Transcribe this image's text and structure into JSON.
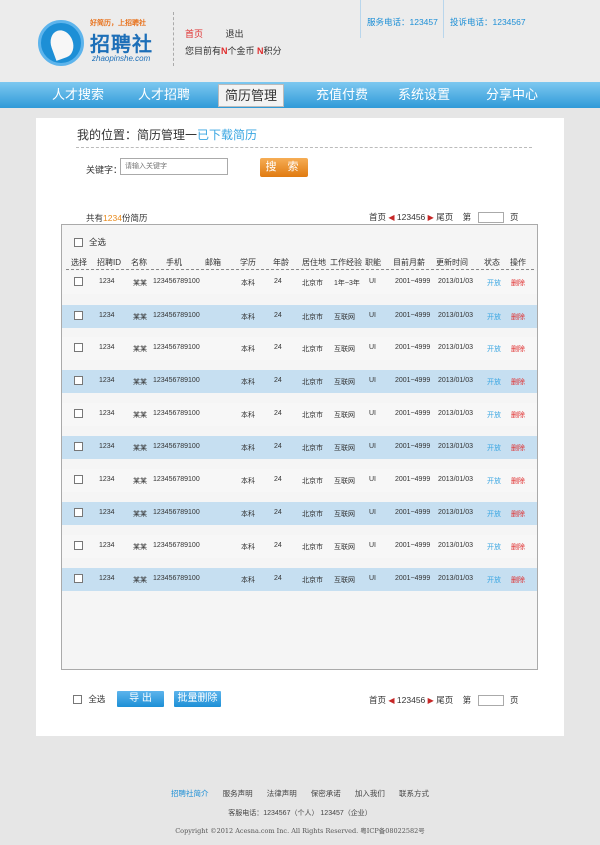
{
  "header": {
    "logo": {
      "slogan": "好简历，上招聘社",
      "name": "招聘社",
      "domain": "zhaopinshe.com",
      "arc_text": "WWW.ZHAOPINSHE.COM"
    },
    "home_link": "首页",
    "logout_link": "退出",
    "coins_prefix": "您目前有",
    "coins_n": "N",
    "coins_mid": "个金币",
    "points_n": "N",
    "points_suffix": "积分",
    "service_phone": "服务电话：123457",
    "complaint_phone": "投诉电话：1234567"
  },
  "nav": {
    "items": [
      {
        "label": "人才搜索"
      },
      {
        "label": "人才招聘"
      },
      {
        "label": "简历管理"
      },
      {
        "label": "充值付费"
      },
      {
        "label": "系统设置"
      },
      {
        "label": "分享中心"
      }
    ],
    "active_index": 2
  },
  "breadcrumb": {
    "prefix": "我的位置：简历管理一",
    "current": "已下载简历"
  },
  "search": {
    "label": "关键字：",
    "placeholder": "请输入关键字",
    "button": "搜 索"
  },
  "summary": {
    "prefix": "共有",
    "count": "1234",
    "suffix": "份简历"
  },
  "pager": {
    "first": "首页",
    "pages": "123456",
    "last": "尾页",
    "page_prefix": "第",
    "page_suffix": "页"
  },
  "table": {
    "select_all": "全选",
    "columns": [
      "选择",
      "招聘ID",
      "名称",
      "手机",
      "邮箱",
      "学历",
      "年龄",
      "居住地",
      "工作经验",
      "职能",
      "目前月薪",
      "更新时间",
      "状态",
      "操作"
    ],
    "rows": [
      {
        "id": "1234",
        "name": "某某",
        "phone": "123456789100",
        "edu": "本科",
        "age": "24",
        "city": "北京市",
        "exp": "1年~3年",
        "func": "UI",
        "salary": "2001~4999",
        "updated": "2013/01/03",
        "status": "开放",
        "action": "删除"
      },
      {
        "id": "1234",
        "name": "某某",
        "phone": "123456789100",
        "edu": "本科",
        "age": "24",
        "city": "北京市",
        "exp": "互联网",
        "func": "UI",
        "salary": "2001~4999",
        "updated": "2013/01/03",
        "status": "开放",
        "action": "删除"
      },
      {
        "id": "1234",
        "name": "某某",
        "phone": "123456789100",
        "edu": "本科",
        "age": "24",
        "city": "北京市",
        "exp": "互联网",
        "func": "UI",
        "salary": "2001~4999",
        "updated": "2013/01/03",
        "status": "开放",
        "action": "删除"
      },
      {
        "id": "1234",
        "name": "某某",
        "phone": "123456789100",
        "edu": "本科",
        "age": "24",
        "city": "北京市",
        "exp": "互联网",
        "func": "UI",
        "salary": "2001~4999",
        "updated": "2013/01/03",
        "status": "开放",
        "action": "删除"
      },
      {
        "id": "1234",
        "name": "某某",
        "phone": "123456789100",
        "edu": "本科",
        "age": "24",
        "city": "北京市",
        "exp": "互联网",
        "func": "UI",
        "salary": "2001~4999",
        "updated": "2013/01/03",
        "status": "开放",
        "action": "删除"
      },
      {
        "id": "1234",
        "name": "某某",
        "phone": "123456789100",
        "edu": "本科",
        "age": "24",
        "city": "北京市",
        "exp": "互联网",
        "func": "UI",
        "salary": "2001~4999",
        "updated": "2013/01/03",
        "status": "开放",
        "action": "删除"
      },
      {
        "id": "1234",
        "name": "某某",
        "phone": "123456789100",
        "edu": "本科",
        "age": "24",
        "city": "北京市",
        "exp": "互联网",
        "func": "UI",
        "salary": "2001~4999",
        "updated": "2013/01/03",
        "status": "开放",
        "action": "删除"
      },
      {
        "id": "1234",
        "name": "某某",
        "phone": "123456789100",
        "edu": "本科",
        "age": "24",
        "city": "北京市",
        "exp": "互联网",
        "func": "UI",
        "salary": "2001~4999",
        "updated": "2013/01/03",
        "status": "开放",
        "action": "删除"
      },
      {
        "id": "1234",
        "name": "某某",
        "phone": "123456789100",
        "edu": "本科",
        "age": "24",
        "city": "北京市",
        "exp": "互联网",
        "func": "UI",
        "salary": "2001~4999",
        "updated": "2013/01/03",
        "status": "开放",
        "action": "删除"
      },
      {
        "id": "1234",
        "name": "某某",
        "phone": "123456789100",
        "edu": "本科",
        "age": "24",
        "city": "北京市",
        "exp": "互联网",
        "func": "UI",
        "salary": "2001~4999",
        "updated": "2013/01/03",
        "status": "开放",
        "action": "删除"
      }
    ]
  },
  "bottom": {
    "select_all": "全选",
    "export": "导 出",
    "batch_delete": "批量删除"
  },
  "footer": {
    "links": [
      "招聘社简介",
      "服务声明",
      "法律声明",
      "保密承诺",
      "加入我们",
      "联系方式"
    ],
    "service": "客服电话：1234567（个人） 123457（企业）",
    "copyright": "Copyright ©2012 Acesna.com Inc. All Rights Reserved. 粤ICP备08022582号"
  },
  "colors": {
    "nav_blue": "#2f9ad8",
    "accent_orange": "#e07a10",
    "row_highlight": "#c6dff1",
    "link_blue": "#3aa6e2",
    "delete_red": "#e02d2d"
  }
}
